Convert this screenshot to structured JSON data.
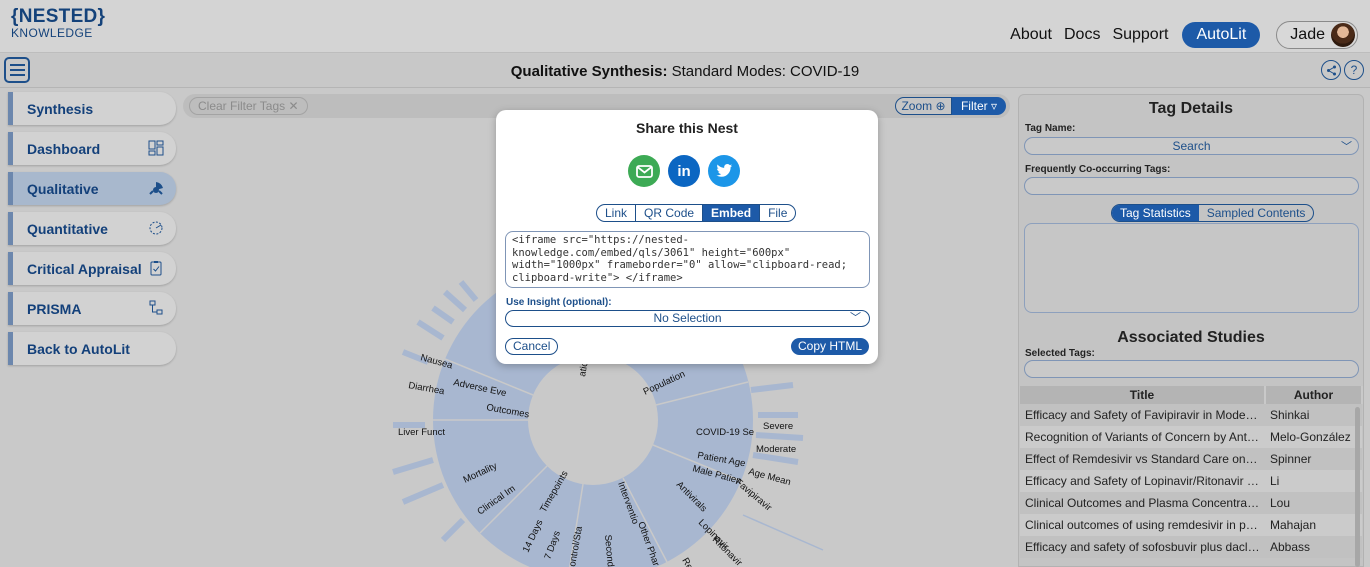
{
  "app": {
    "logo_line1": "{NESTED}",
    "logo_line2": "KNOWLEDGE"
  },
  "topnav": {
    "links": [
      "About",
      "Docs",
      "Support"
    ],
    "autolit_label": "AutoLit",
    "user_name": "Jade"
  },
  "header": {
    "title_bold": "Qualitative Synthesis:",
    "title_rest": " Standard Modes: COVID-19",
    "share_icon": "share-icon",
    "help_icon": "?"
  },
  "sidebar": {
    "items": [
      {
        "label": "Synthesis",
        "icon": ""
      },
      {
        "label": "Dashboard",
        "icon": "dashboard-icon"
      },
      {
        "label": "Qualitative",
        "icon": "qualitative-icon"
      },
      {
        "label": "Quantitative",
        "icon": "quantitative-icon"
      },
      {
        "label": "Critical Appraisal",
        "icon": "clipboard-icon"
      },
      {
        "label": "PRISMA",
        "icon": "flowchart-icon"
      },
      {
        "label": "Back to AutoLit",
        "icon": ""
      }
    ]
  },
  "filterbar": {
    "clear_label": "Clear Filter Tags",
    "zoom_label": "Zoom",
    "filter_label": "Filter"
  },
  "sunburst_labels": {
    "nausea": "Nausea",
    "adverse": "Adverse Eve",
    "diarrhea": "Diarrhea",
    "outcomes": "Outcomes",
    "liver": "Liver Funct",
    "mortality": "Mortality",
    "clinical": "Clinical Im",
    "timepoints": "Timepoints",
    "days14": "14 Days",
    "days7": "7 Days",
    "control": "ontrol/Sta",
    "second": "Seconda",
    "intervention": "Interventio",
    "otherphar": "Other Phar",
    "antivirals": "Antivirals",
    "lopinavir": "Lopinavir",
    "ritonavir": "Ritonavir",
    "re": "Re",
    "favipiravir": "Favipiravir",
    "population": "Population",
    "covid": "COVID-19 Se",
    "severe": "Severe",
    "moderate": "Moderate",
    "patientage": "Patient Age",
    "agemean": "Age Mean",
    "male": "Male Patien",
    "ati": "atic"
  },
  "tag_details": {
    "title": "Tag Details",
    "tag_name_label": "Tag Name:",
    "search_placeholder": "Search",
    "cooccur_label": "Frequently Co-occurring Tags:",
    "tab_stats": "Tag Statistics",
    "tab_sampled": "Sampled Contents"
  },
  "associated": {
    "title": "Associated Studies",
    "selected_label": "Selected Tags:",
    "columns": [
      "Title",
      "Author"
    ],
    "rows": [
      {
        "title": "Efficacy and Safety of Favipiravir in Moderate ...",
        "author": "Shinkai"
      },
      {
        "title": "Recognition of Variants of Concern by Antibod...",
        "author": "Melo-González"
      },
      {
        "title": "Effect of Remdesivir vs Standard Care on Clin...",
        "author": "Spinner"
      },
      {
        "title": "Efficacy and Safety of Lopinavir/Ritonavir or A...",
        "author": "Li"
      },
      {
        "title": "Clinical Outcomes and Plasma Concentration...",
        "author": "Lou"
      },
      {
        "title": "Clinical outcomes of using remdesivir in patien...",
        "author": "Mahajan"
      },
      {
        "title": "Efficacy and safety of sofosbuvir plus daclatas...",
        "author": "Abbass"
      }
    ]
  },
  "modal": {
    "title": "Share this Nest",
    "tabs": [
      "Link",
      "QR Code",
      "Embed",
      "File"
    ],
    "active_tab": "Embed",
    "embed_code": "<iframe src=\"https://nested-knowledge.com/embed/qls/3061\" height=\"600px\" width=\"1000px\" frameborder=\"0\" allow=\"clipboard-read; clipboard-write\"> </iframe>",
    "insight_label": "Use Insight (optional):",
    "insight_value": "No Selection",
    "cancel_label": "Cancel",
    "copy_label": "Copy HTML"
  },
  "colors": {
    "brand_blue": "#1d5aa8",
    "email_green": "#3daa55",
    "linkedin_blue": "#0b66c2",
    "twitter_blue": "#1c96e8",
    "sunburst_fill": "#a8b7d0"
  }
}
